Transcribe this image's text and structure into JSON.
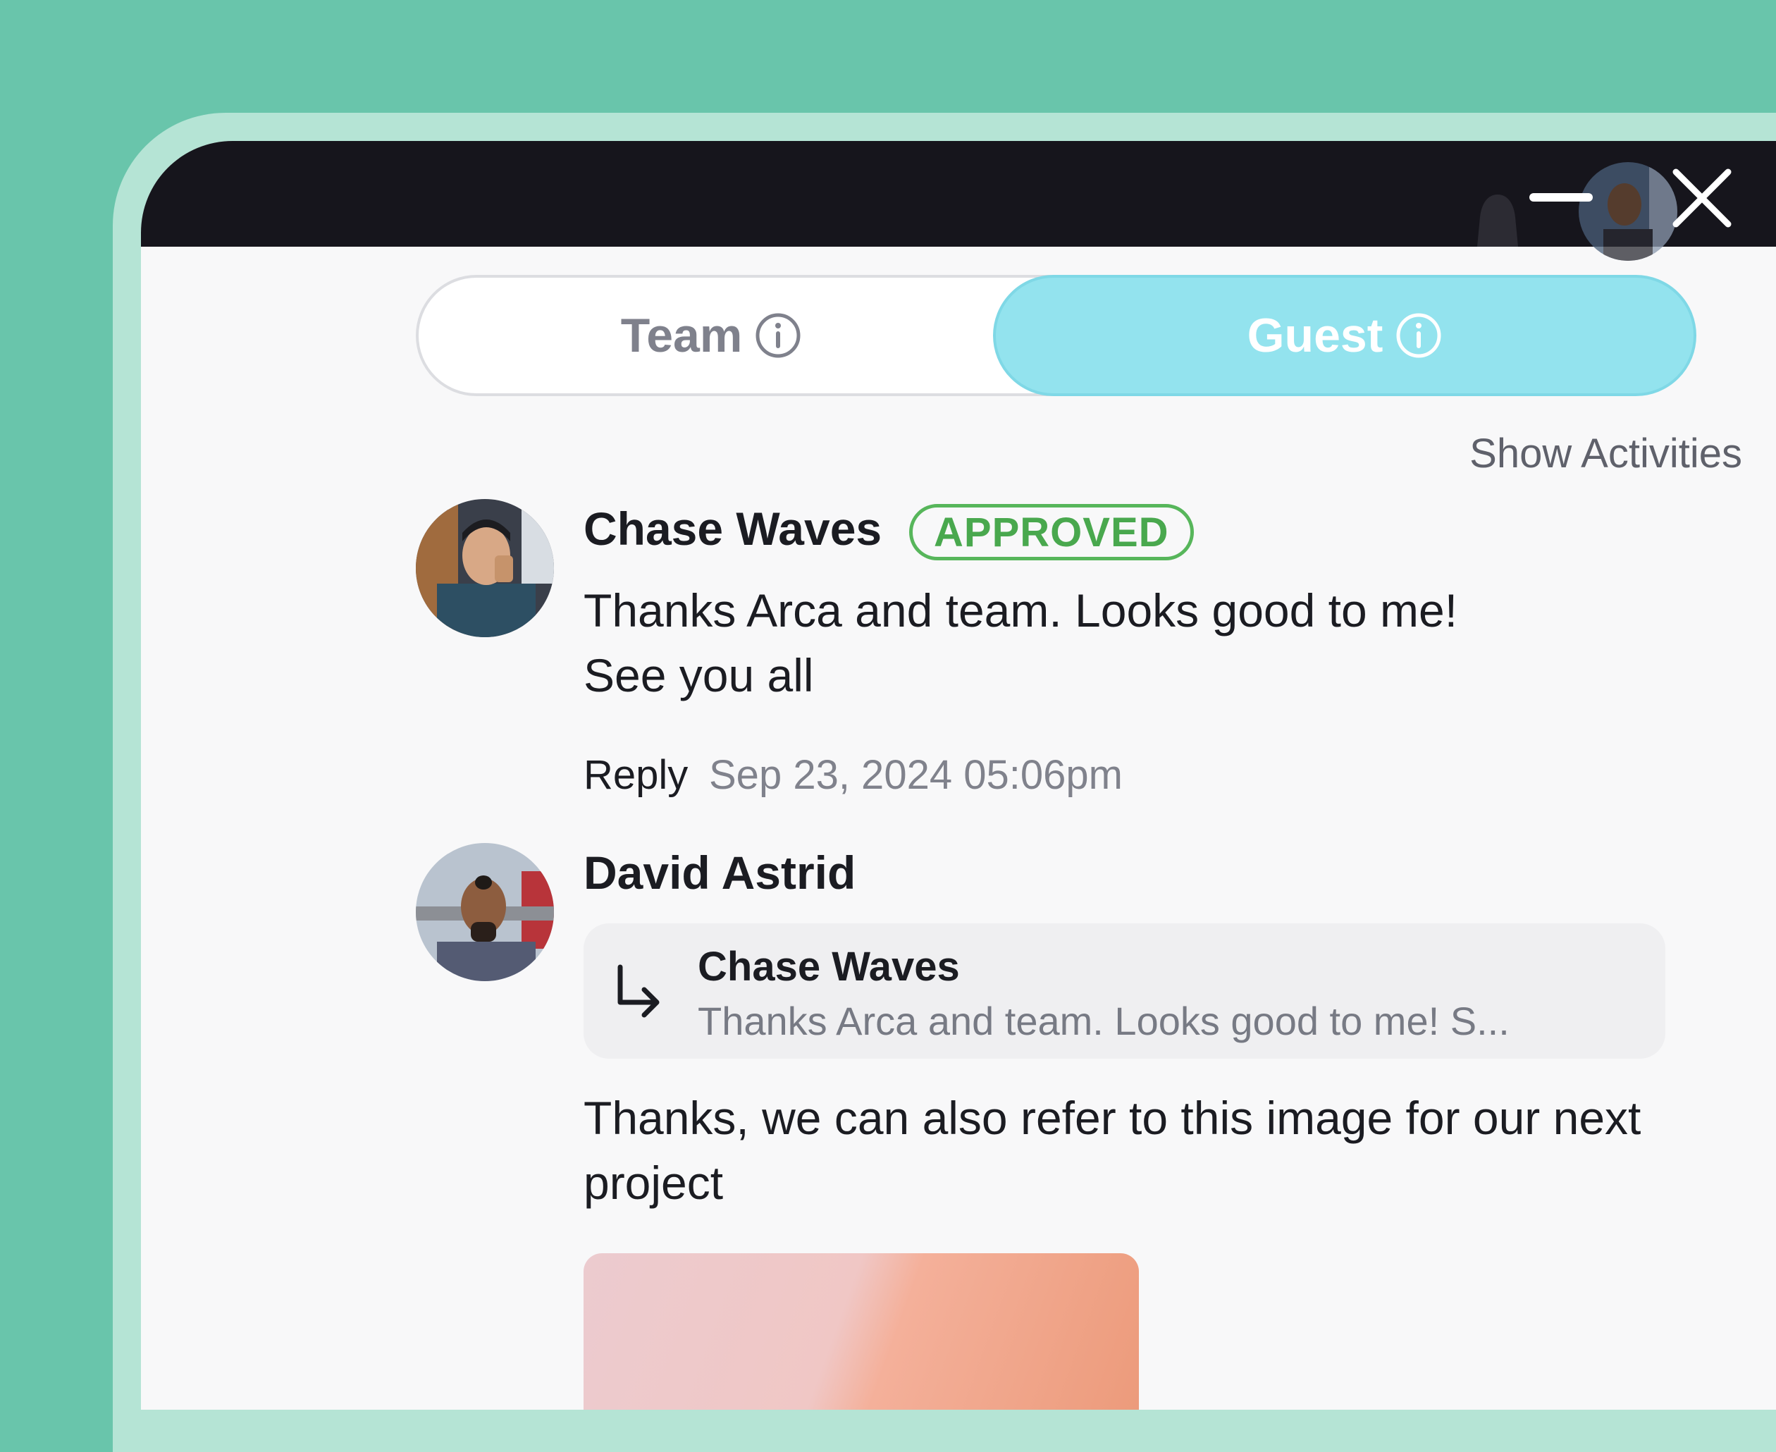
{
  "tabs": [
    {
      "label": "Team",
      "active": false
    },
    {
      "label": "Guest",
      "active": true
    }
  ],
  "show_activities_label": "Show Activities",
  "comments": [
    {
      "author": "Chase Waves",
      "badge": "APPROVED",
      "message": "Thanks Arca and team. Looks good to me! See you all",
      "reply_label": "Reply",
      "timestamp": "Sep 23, 2024 05:06pm"
    },
    {
      "author": "David Astrid",
      "quote": {
        "author": "Chase Waves",
        "text": "Thanks Arca and team. Looks good to me! S..."
      },
      "message": "Thanks, we can also refer to this image for our next project"
    }
  ],
  "colors": {
    "background": "#69c5ab",
    "titlebar": "#16151c",
    "active_tab": "#93e3ee",
    "approved": "#57b65b"
  },
  "icons": [
    "bell-icon",
    "minimize-icon",
    "close-icon",
    "info-icon",
    "reply-arrow-icon"
  ]
}
